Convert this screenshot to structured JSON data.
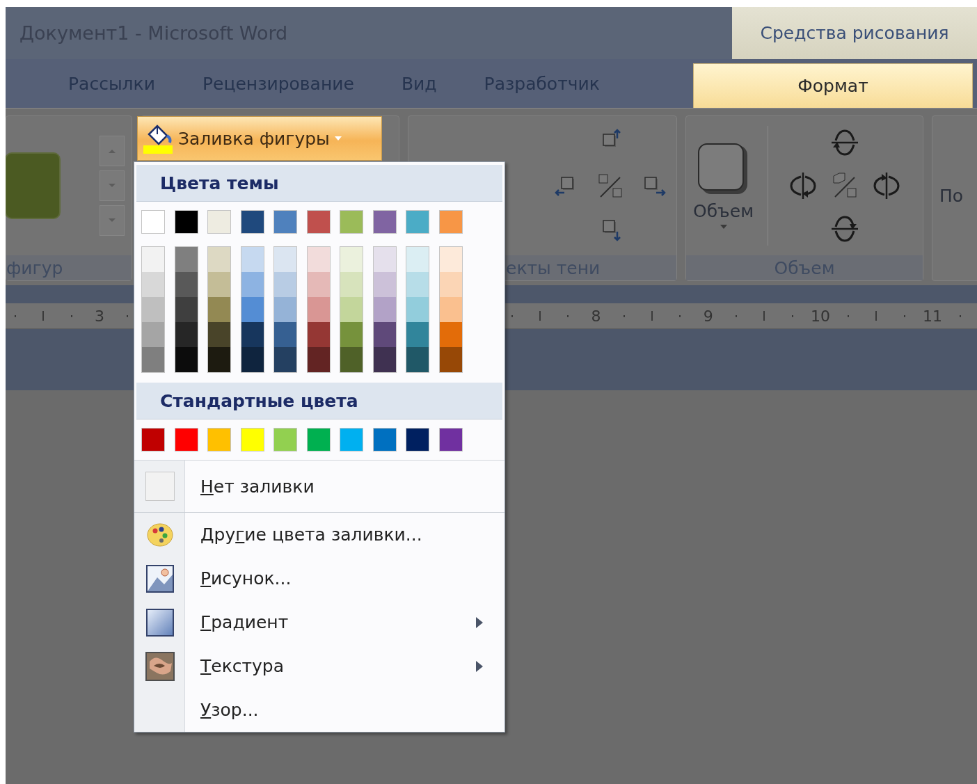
{
  "window": {
    "title": "Документ1  - Microsoft Word",
    "context_group": "Средства рисования"
  },
  "tabs": [
    {
      "label": "Рассылки",
      "selected": false
    },
    {
      "label": "Рецензирование",
      "selected": false
    },
    {
      "label": "Вид",
      "selected": false
    },
    {
      "label": "Разработчик",
      "selected": false
    },
    {
      "label": "Формат",
      "selected": true
    }
  ],
  "ribbon": {
    "groups": [
      {
        "kind": "gallery",
        "label": "фигур"
      },
      {
        "kind": "fill"
      },
      {
        "kind": "shadow",
        "label": "екты тени"
      },
      {
        "kind": "volume",
        "label": "Объем",
        "button": "Объем"
      },
      {
        "kind": "cut",
        "button": "По"
      }
    ]
  },
  "fill_button": {
    "label": "Заливка фигуры",
    "open": true
  },
  "ruler": {
    "left_numbers": [
      "3"
    ],
    "right_numbers": [
      "8",
      "9",
      "10",
      "11"
    ]
  },
  "fill_menu": {
    "theme_colors": {
      "title": "Цвета темы",
      "base": [
        {
          "color": "#ffffff"
        },
        {
          "color": "#000000"
        },
        {
          "color": "#eeece1"
        },
        {
          "color": "#1f497d"
        },
        {
          "color": "#4f81bd"
        },
        {
          "color": "#c0504d"
        },
        {
          "color": "#9bbb59"
        },
        {
          "color": "#8064a2"
        },
        {
          "color": "#4bacc6"
        },
        {
          "color": "#f79646"
        }
      ],
      "shades": [
        [
          {
            "color": "#f2f2f2"
          },
          {
            "color": "#d8d8d8"
          },
          {
            "color": "#bfbfbf"
          },
          {
            "color": "#a5a5a5"
          },
          {
            "color": "#7f7f7f"
          }
        ],
        [
          {
            "color": "#7f7f7f"
          },
          {
            "color": "#595959"
          },
          {
            "color": "#3f3f3f"
          },
          {
            "color": "#262626"
          },
          {
            "color": "#0c0c0c"
          }
        ],
        [
          {
            "color": "#ddd9c3"
          },
          {
            "color": "#c4bd97"
          },
          {
            "color": "#938953"
          },
          {
            "color": "#494429"
          },
          {
            "color": "#1d1b10"
          }
        ],
        [
          {
            "color": "#c6d9f0"
          },
          {
            "color": "#8db3e2"
          },
          {
            "color": "#548dd4"
          },
          {
            "color": "#17365d"
          },
          {
            "color": "#0f243e"
          }
        ],
        [
          {
            "color": "#dbe5f1"
          },
          {
            "color": "#b8cce4"
          },
          {
            "color": "#95b3d7"
          },
          {
            "color": "#366092"
          },
          {
            "color": "#244061"
          }
        ],
        [
          {
            "color": "#f2dcdb"
          },
          {
            "color": "#e5b9b7"
          },
          {
            "color": "#d99694"
          },
          {
            "color": "#953734"
          },
          {
            "color": "#632423"
          }
        ],
        [
          {
            "color": "#ebf1dd"
          },
          {
            "color": "#d7e3bc"
          },
          {
            "color": "#c3d69b"
          },
          {
            "color": "#76923c"
          },
          {
            "color": "#4f6128"
          }
        ],
        [
          {
            "color": "#e5e0ec"
          },
          {
            "color": "#ccc1d9"
          },
          {
            "color": "#b2a2c7"
          },
          {
            "color": "#5f497a"
          },
          {
            "color": "#3f3151"
          }
        ],
        [
          {
            "color": "#dbeef3"
          },
          {
            "color": "#b7dde8"
          },
          {
            "color": "#92cddc"
          },
          {
            "color": "#31859b"
          },
          {
            "color": "#205867"
          }
        ],
        [
          {
            "color": "#fdeada"
          },
          {
            "color": "#fbd5b5"
          },
          {
            "color": "#fac08f"
          },
          {
            "color": "#e36c09"
          },
          {
            "color": "#974806"
          }
        ]
      ]
    },
    "standard_colors": {
      "title": "Стандартные цвета",
      "colors": [
        {
          "color": "#c00000"
        },
        {
          "color": "#ff0000"
        },
        {
          "color": "#ffc000"
        },
        {
          "color": "#ffff00"
        },
        {
          "color": "#92d050"
        },
        {
          "color": "#00b050"
        },
        {
          "color": "#00b0f0"
        },
        {
          "color": "#0070c0"
        },
        {
          "color": "#002060"
        },
        {
          "color": "#7030a0"
        }
      ]
    },
    "items": [
      {
        "kind": "no-fill",
        "access_key": "Н",
        "text_after": "ет заливки",
        "submenu": false
      },
      {
        "kind": "more-colors",
        "text_before": "Дру",
        "access_key": "г",
        "text_after": "ие цвета заливки...",
        "submenu": false
      },
      {
        "kind": "picture",
        "access_key": "Р",
        "text_after": "исунок...",
        "submenu": false
      },
      {
        "kind": "gradient",
        "access_key": "Г",
        "text_after": "радиент",
        "submenu": true
      },
      {
        "kind": "texture",
        "access_key": "Т",
        "text_after": "екстура",
        "submenu": true
      },
      {
        "kind": "pattern",
        "access_key": "У",
        "text_after": "зор...",
        "submenu": false
      }
    ]
  }
}
